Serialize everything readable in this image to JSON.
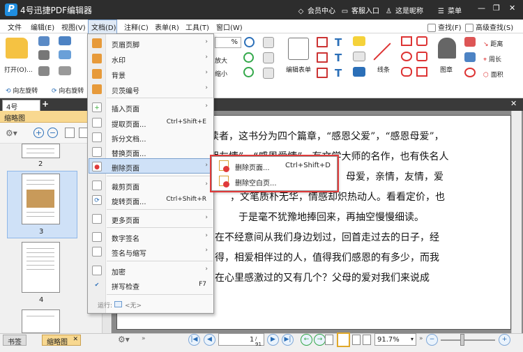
{
  "app": {
    "title": "4号迅捷PDF编辑器",
    "logo_letter": "P"
  },
  "titlebar": {
    "member": "会员中心",
    "service": "客服入口",
    "user": "这是昵称",
    "menu": "菜单"
  },
  "menubar": [
    "文件",
    "编辑(E)",
    "视图(V)",
    "文档(D)",
    "注释(C)",
    "表单(R)",
    "工具(T)",
    "窗口(W)"
  ],
  "toolbar": {
    "open": "打开(O)...",
    "rotate_left": "向左旋转",
    "rotate_right": "向右旋转",
    "find": "查找(F)",
    "advanced_find": "高级查找(S)",
    "zoom_percent": "%",
    "zoom_in": "放大",
    "zoom_out": "缩小",
    "edit_form": "编辑表单",
    "lines": "线条",
    "stamp": "图章",
    "distance": "距离",
    "perimeter": "周长",
    "area": "面积"
  },
  "tabs": {
    "doc_tab": "4号"
  },
  "left_panel": {
    "title": "缩略图",
    "pages": [
      "2",
      "3",
      "4"
    ]
  },
  "bottom": {
    "outline_tab": "书签",
    "thumb_tab": "缩略图",
    "page_field": "1",
    "page_total": "/ 91",
    "zoom": "91.7%"
  },
  "document": {
    "lines": [
      "读者，这书分为四个篇章，“感恩父爱”，“感恩母爱”，",
      "朋友情”，“感恩爱情”，有文学大师的名作，也有佚名人",
      "母爱，亲情，友情，爱",
      "，文笔质朴无华，情感却炽热动人。看看定价，也",
      "于是毫不犹豫地捧回来，再抽空慢慢细读。",
      "在不经意间从我们身边划过，回首走过去的日子，经",
      "得，相爱相伴过的人，值得我们感恩的有多少，而我",
      "在心里感激过的又有几个？父母的爱对我们来说成"
    ]
  },
  "doc_menu": {
    "items": [
      {
        "label": "页眉页脚",
        "arrow": "›"
      },
      {
        "label": "水印",
        "arrow": "›"
      },
      {
        "label": "背景",
        "arrow": "›"
      },
      {
        "label": "贝茨编号",
        "arrow": "›"
      },
      {
        "label": "插入页面",
        "arrow": "›"
      },
      {
        "label": "提取页面...",
        "shortcut": "Ctrl+Shift+E"
      },
      {
        "label": "拆分文档..."
      },
      {
        "label": "替换页面..."
      },
      {
        "label": "删除页面",
        "arrow": "›"
      },
      {
        "label": "裁剪页面",
        "arrow": "›"
      },
      {
        "label": "旋转页面...",
        "shortcut": "Ctrl+Shift+R"
      },
      {
        "label": "更多页面",
        "arrow": "›"
      },
      {
        "label": "数字签名",
        "arrow": "›"
      },
      {
        "label": "签名与缩写",
        "arrow": "›"
      },
      {
        "label": "加密",
        "arrow": "›"
      },
      {
        "label": "拼写检查",
        "shortcut": "F7"
      }
    ],
    "run_label": "运行:",
    "run_value": "<无>"
  },
  "submenu": {
    "items": [
      {
        "label": "删除页面...",
        "shortcut": "Ctrl+Shift+D"
      },
      {
        "label": "删除空白页..."
      }
    ]
  },
  "colors": {
    "titlebar": "#2d2d2d",
    "highlight": "#cfe1f7",
    "accent_red": "#e03a3a",
    "thumb_header": "#f8d890"
  }
}
